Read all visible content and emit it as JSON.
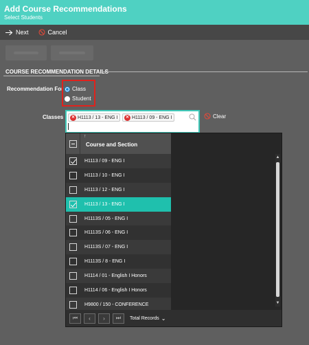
{
  "header": {
    "title": "Add Course Recommendations",
    "subtitle": "Select Students"
  },
  "toolbar": {
    "next_label": "Next",
    "cancel_label": "Cancel"
  },
  "section_title": "COURSE RECOMMENDATION DETAILS",
  "recommendation": {
    "label": "Recommendation For",
    "options": [
      {
        "label": "Class",
        "selected": true
      },
      {
        "label": "Student",
        "selected": false
      }
    ]
  },
  "classes": {
    "label": "Classes",
    "chips": [
      "H1113 / 13 - ENG I",
      "H1113 / 09 - ENG I"
    ],
    "clear_label": "Clear"
  },
  "grid": {
    "column_header": "Course and Section",
    "rows": [
      {
        "label": "H1113 / 09 - ENG I",
        "checked": true
      },
      {
        "label": "H1113 / 10 - ENG I",
        "checked": false
      },
      {
        "label": "H1113 / 12 - ENG I",
        "checked": false
      },
      {
        "label": "H1113 / 13 - ENG I",
        "checked": true,
        "highlighted": true
      },
      {
        "label": "H1113S / 05 - ENG I",
        "checked": false
      },
      {
        "label": "H1113S / 06 - ENG I",
        "checked": false
      },
      {
        "label": "H1113S / 07 - ENG I",
        "checked": false
      },
      {
        "label": "H1113S / 8 - ENG I",
        "checked": false
      },
      {
        "label": "H1114 / 01 - English I Honors",
        "checked": false
      },
      {
        "label": "H1114 / 06 - English I Honors",
        "checked": false
      },
      {
        "label": "H9800 / 150 - CONFERENCE",
        "checked": false
      }
    ],
    "pager": {
      "total_label": "Total Records"
    }
  },
  "colors": {
    "accent": "#4fd1c2",
    "selected_row": "#1fc0ad",
    "highlight_box": "#e0221c",
    "chip_remove": "#d33333"
  }
}
